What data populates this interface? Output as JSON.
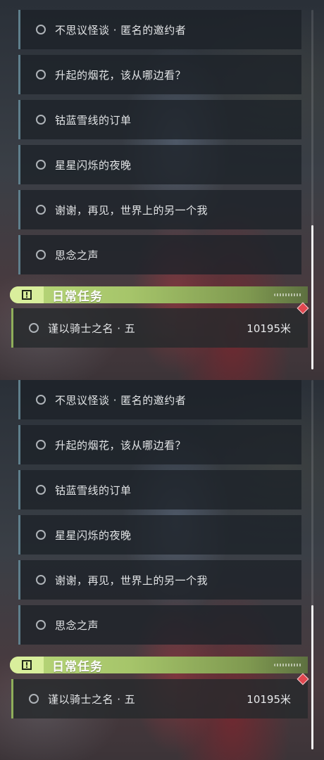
{
  "panels": [
    {
      "quests": [
        {
          "label": "不思议怪谈 · 匿名的邀约者"
        },
        {
          "label": "升起的烟花，该从哪边看？"
        },
        {
          "label": "钴蓝雪线的订单"
        },
        {
          "label": "星星闪烁的夜晚"
        },
        {
          "label": "谢谢，再见，世界上的另一个我"
        },
        {
          "label": "思念之声"
        }
      ],
      "daily": {
        "section_title": "日常任务",
        "icon_glyph": "!",
        "item_label": "谨以骑士之名 · 五",
        "distance": "10195米"
      }
    },
    {
      "quests": [
        {
          "label": "不思议怪谈 · 匿名的邀约者"
        },
        {
          "label": "升起的烟花，该从哪边看？"
        },
        {
          "label": "钴蓝雪线的订单"
        },
        {
          "label": "星星闪烁的夜晚"
        },
        {
          "label": "谢谢，再见，世界上的另一个我"
        },
        {
          "label": "思念之声"
        }
      ],
      "daily": {
        "section_title": "日常任务",
        "icon_glyph": "!",
        "item_label": "谨以骑士之名 · 五",
        "distance": "10195米"
      }
    }
  ],
  "colors": {
    "accent_green": "#b9d77a",
    "quest_border": "#5f7f8c",
    "marker_red": "#e0474f"
  }
}
